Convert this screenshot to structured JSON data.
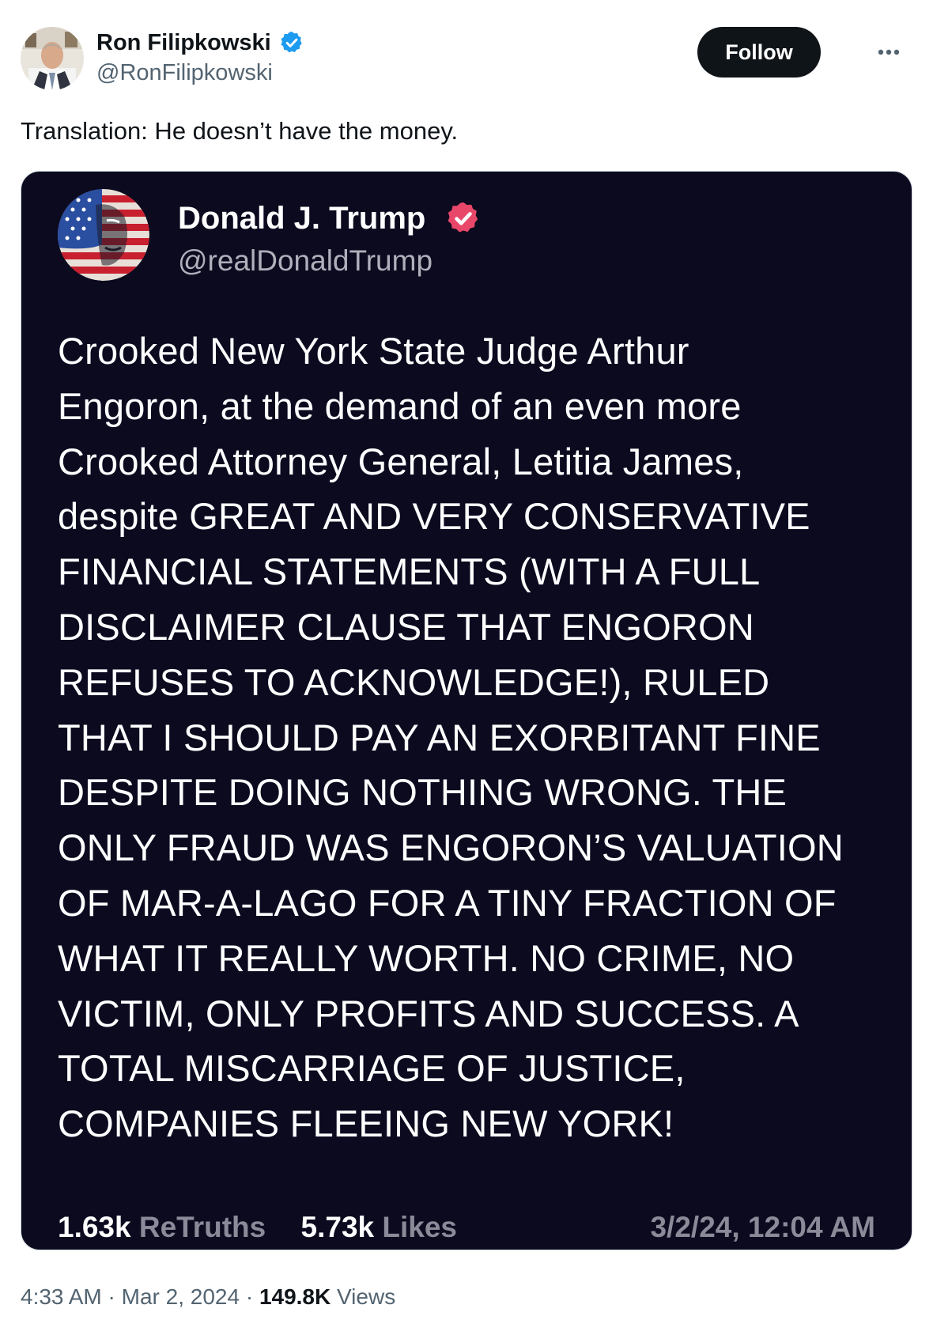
{
  "author": {
    "display_name": "Ron Filipkowski",
    "handle": "@RonFilipkowski",
    "verified_color": "#1d9bf0"
  },
  "actions": {
    "follow_label": "Follow",
    "more_icon": "more-horizontal-icon"
  },
  "tweet": {
    "text": "Translation: He doesn’t have the money."
  },
  "embedded_post": {
    "display_name": "Donald J. Trump",
    "handle": "@realDonaldTrump",
    "verified_color": "#e8476a",
    "body": "Crooked New York State Judge Arthur\nEngoron, at the demand of an even more\nCrooked Attorney General, Letitia James,\ndespite GREAT AND VERY CONSERVATIVE\nFINANCIAL STATEMENTS (WITH A FULL\nDISCLAIMER CLAUSE THAT ENGORON\nREFUSES TO ACKNOWLEDGE!), RULED\nTHAT I SHOULD PAY AN EXORBITANT FINE\nDESPITE DOING NOTHING WRONG. THE\nONLY FRAUD WAS ENGORON’S VALUATION\nOF MAR-A-LAGO FOR A TINY FRACTION OF\nWHAT IT REALLY WORTH. NO CRIME, NO\nVICTIM, ONLY PROFITS AND SUCCESS. A\nTOTAL MISCARRIAGE OF JUSTICE,\nCOMPANIES FLEEING NEW YORK!",
    "retruths_count": "1.63k",
    "retruths_label": "ReTruths",
    "likes_count": "5.73k",
    "likes_label": "Likes",
    "timestamp": "3/2/24, 12:04 AM",
    "background": "#0b0a1f"
  },
  "meta": {
    "time": "4:33 AM",
    "separator": "·",
    "date": "Mar 2, 2024",
    "views_count": "149.8K",
    "views_label": "Views"
  }
}
